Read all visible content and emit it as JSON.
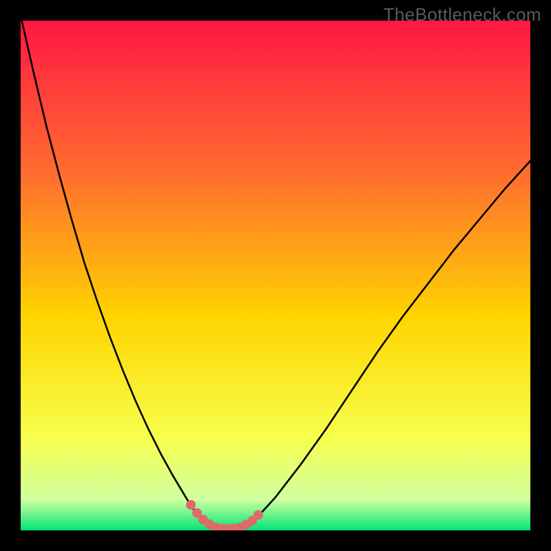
{
  "watermark": "TheBottleneck.com",
  "colors": {
    "frame": "#000000",
    "gradient_top": "#ff1744",
    "gradient_upper_mid": "#ff6d2f",
    "gradient_mid": "#ffd400",
    "gradient_lower_mid": "#f6ff4d",
    "gradient_near_bottom": "#d0ffa0",
    "gradient_bottom": "#00e676",
    "curve": "#000000",
    "marker_fill": "#e06a6a",
    "marker_stroke": "#c94f4f"
  },
  "chart_data": {
    "type": "line",
    "title": "",
    "xlabel": "",
    "ylabel": "",
    "xlim": [
      0,
      100
    ],
    "ylim": [
      0,
      100
    ],
    "note": "Axes are unlabeled; x and y are normalized 0–100 from plot-area left→right and bottom→top. Values are read off the rendered curve (approximate).",
    "series": [
      {
        "name": "bottleneck-curve",
        "x": [
          0,
          2.5,
          5,
          7.5,
          10,
          12.5,
          15,
          17.5,
          20,
          22.5,
          25,
          27.5,
          30,
          31.5,
          33,
          34,
          35.5,
          37,
          38,
          39,
          40,
          41.5,
          43,
          45,
          47,
          50,
          55,
          60,
          65,
          70,
          75,
          80,
          85,
          90,
          95,
          100
        ],
        "y": [
          101,
          90,
          79.5,
          70,
          61,
          52.5,
          45,
          38,
          31.5,
          25.5,
          20,
          15,
          10.5,
          8,
          5.5,
          4,
          2.5,
          1.3,
          0.7,
          0.4,
          0.3,
          0.3,
          0.6,
          1.5,
          3.2,
          6.5,
          13,
          20,
          27.5,
          35,
          42,
          48.5,
          55,
          61,
          67,
          72.5
        ]
      }
    ],
    "markers": {
      "name": "highlight-trough",
      "note": "Pink dotted markers tracing the flat trough of the curve.",
      "points_xy": [
        [
          33.4,
          5.0
        ],
        [
          34.6,
          3.4
        ],
        [
          35.8,
          2.1
        ],
        [
          37.0,
          1.2
        ],
        [
          38.2,
          0.6
        ],
        [
          39.4,
          0.35
        ],
        [
          40.6,
          0.3
        ],
        [
          41.8,
          0.35
        ],
        [
          43.0,
          0.55
        ],
        [
          44.2,
          1.1
        ],
        [
          45.4,
          1.9
        ],
        [
          46.6,
          3.0
        ]
      ],
      "radius_px": 7
    },
    "gradient_stops": [
      {
        "offset": 0.0,
        "color_key": "gradient_top"
      },
      {
        "offset": 0.3,
        "color_key": "gradient_upper_mid"
      },
      {
        "offset": 0.58,
        "color_key": "gradient_mid"
      },
      {
        "offset": 0.82,
        "color_key": "gradient_lower_mid"
      },
      {
        "offset": 0.94,
        "color_key": "gradient_near_bottom"
      },
      {
        "offset": 1.0,
        "color_key": "gradient_bottom"
      }
    ]
  }
}
